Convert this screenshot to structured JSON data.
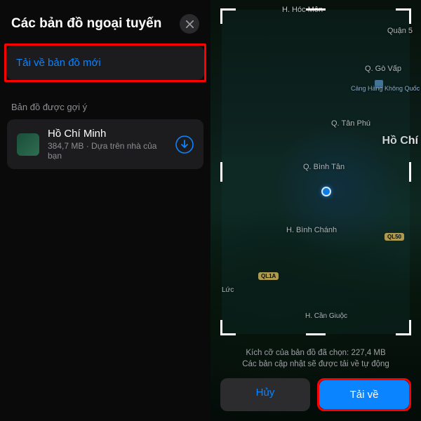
{
  "left": {
    "title": "Các bản đồ ngoại tuyến",
    "downloadNew": "Tải về bản đồ mới",
    "sectionLabel": "Bản đồ được gợi ý",
    "suggestion": {
      "title": "Hồ Chí Minh",
      "subtitle": "384,7 MB · Dựa trên nhà của bạn"
    }
  },
  "map": {
    "labels": {
      "hocmon": "H. Hóc Môn",
      "quan5": "Quận 5",
      "govap": "Q. Gò Vấp",
      "tanphu": "Q. Tân Phú",
      "binhtan": "Q. Bình Tân",
      "binhchanh": "H. Bình Chánh",
      "luc": "Lức",
      "cangiuoc": "H. Cần Giuộc",
      "hochi": "Hồ Chí",
      "airport": "Cảng Hàng Không Quốc Tế Tân Sơn Nhất (SGN)",
      "road1": "QL50",
      "road2": "QL1A"
    }
  },
  "bottom": {
    "sizeLine": "Kích cỡ của bản đồ đã chọn: 227,4 MB",
    "updateLine": "Các bản cập nhật sẽ được tải về tự động",
    "cancel": "Hủy",
    "download": "Tải về"
  }
}
